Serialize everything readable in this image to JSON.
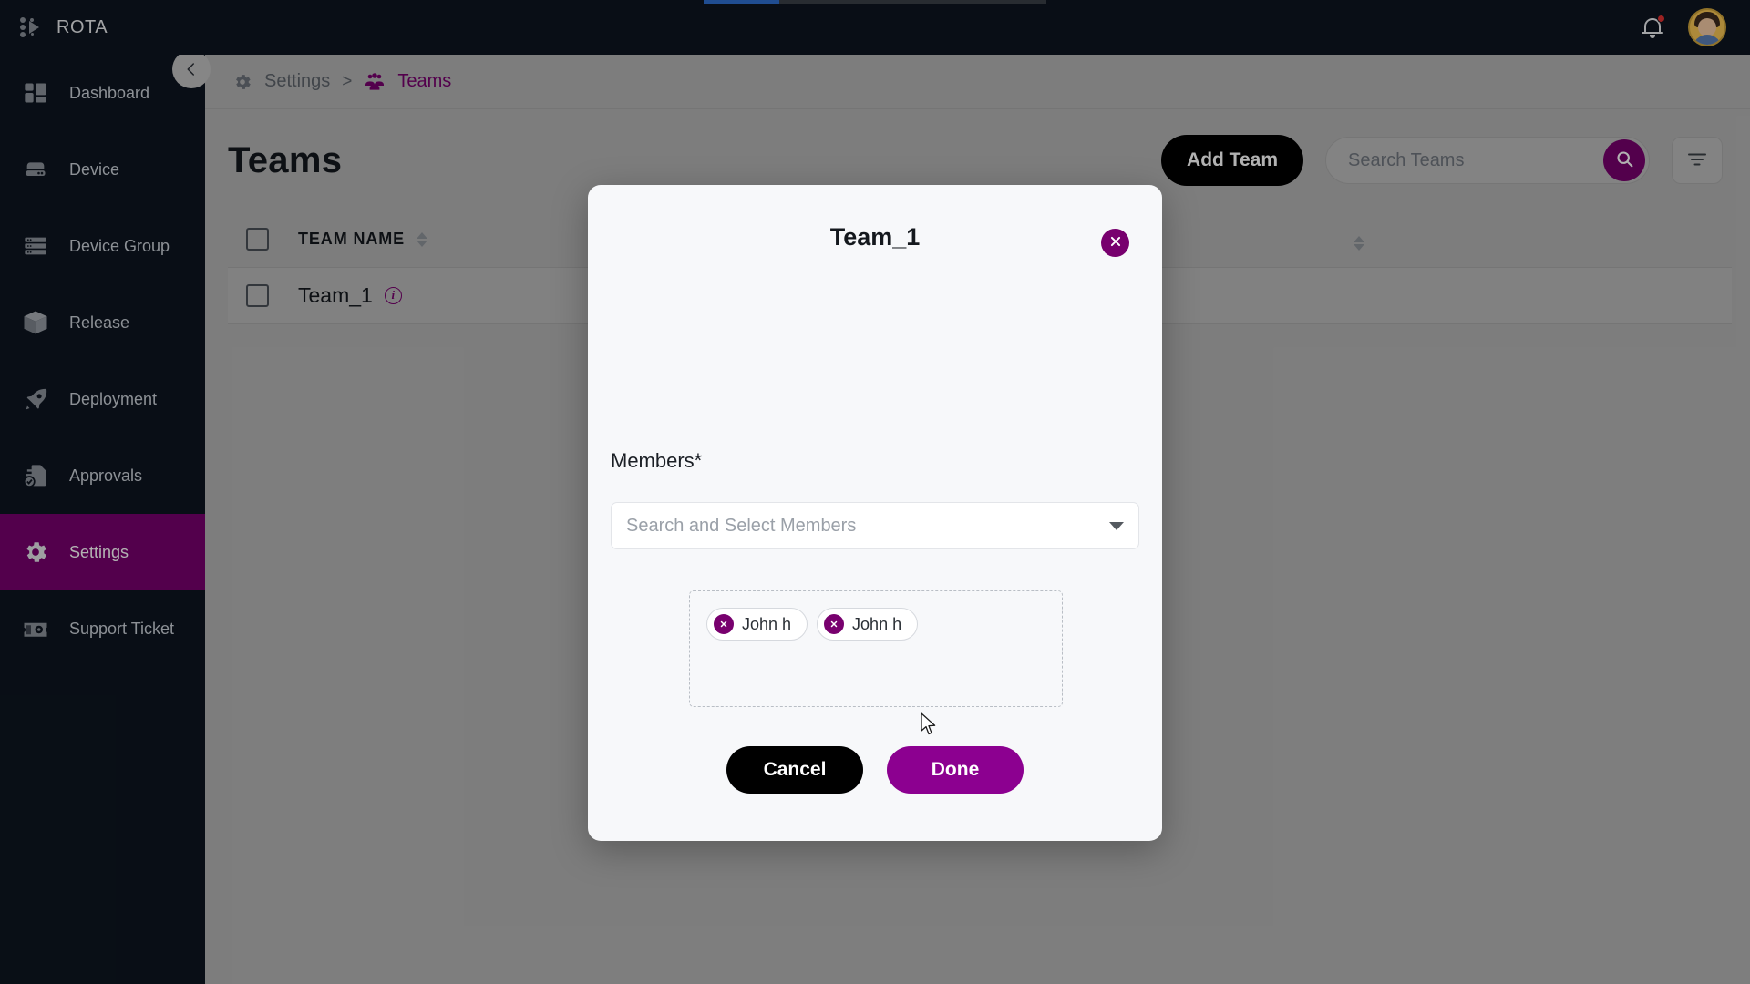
{
  "app": {
    "brand": "ROTA",
    "logo_icon": "rota-logo-icon",
    "notification_icon": "bell-icon",
    "avatar_icon": "user-avatar"
  },
  "sidebar": {
    "collapse_icon": "chevron-left-icon",
    "items": [
      {
        "label": "Dashboard",
        "icon": "dashboard-icon",
        "active": false
      },
      {
        "label": "Device",
        "icon": "device-icon",
        "active": false
      },
      {
        "label": "Device Group",
        "icon": "device-group-icon",
        "active": false
      },
      {
        "label": "Release",
        "icon": "release-box-icon",
        "active": false
      },
      {
        "label": "Deployment",
        "icon": "rocket-icon",
        "active": false
      },
      {
        "label": "Approvals",
        "icon": "approvals-icon",
        "active": false
      },
      {
        "label": "Settings",
        "icon": "gear-icon",
        "active": true
      },
      {
        "label": "Support Ticket",
        "icon": "support-ticket-icon",
        "active": false
      }
    ]
  },
  "breadcrumb": {
    "parent": "Settings",
    "parent_icon": "gear-icon",
    "separator": ">",
    "current": "Teams",
    "current_icon": "teams-people-icon"
  },
  "page": {
    "title": "Teams",
    "add_button": "Add Team",
    "search_placeholder": "Search Teams",
    "search_value": "",
    "search_icon": "search-icon",
    "filter_icon": "filter-icon"
  },
  "table": {
    "columns": [
      "TEAM NAME"
    ],
    "sort_icon": "sort-arrows-icon",
    "select_all_icon": "checkbox-unchecked",
    "rows": [
      {
        "checkbox": "checkbox-unchecked",
        "name": "Team_1",
        "info_icon": "info-icon"
      }
    ]
  },
  "modal": {
    "title": "Team_1",
    "close_icon": "close-x-icon",
    "members_label": "Members*",
    "select_placeholder": "Search and Select Members",
    "select_value": "",
    "dropdown_icon": "chevron-down-icon",
    "chips": [
      {
        "label": "John h",
        "remove_icon": "remove-x-icon"
      },
      {
        "label": "John h",
        "remove_icon": "remove-x-icon"
      }
    ],
    "cancel_label": "Cancel",
    "done_label": "Done"
  },
  "colors": {
    "brand_purple": "#78006e",
    "done_purple": "#8c0090",
    "sidebar_bg": "#0d1520",
    "content_bg": "#b4b4b4",
    "black": "#000000",
    "notification_red": "#e03131"
  }
}
